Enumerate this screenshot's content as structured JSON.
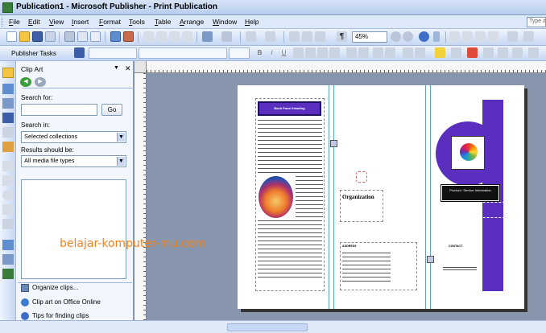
{
  "window": {
    "title": "Publication1 - Microsoft Publisher - Print Publication"
  },
  "menu": [
    "File",
    "Edit",
    "View",
    "Insert",
    "Format",
    "Tools",
    "Table",
    "Arrange",
    "Window",
    "Help"
  ],
  "help_box": {
    "placeholder": "Type a"
  },
  "toolbar": {
    "zoom": "45%",
    "publisher_tasks": "Publisher Tasks"
  },
  "taskpane": {
    "title": "Clip Art",
    "search_for_label": "Search for:",
    "search_value": "",
    "go_label": "Go",
    "search_in_label": "Search in:",
    "search_in_value": "Selected collections",
    "results_label": "Results should be:",
    "results_value": "All media file types",
    "links": [
      "Organize clips...",
      "Clip art on Office Online",
      "Tips for finding clips"
    ]
  },
  "page": {
    "heading": "Back Panel Heading",
    "organization": "Organization",
    "product": "Product / Service Information",
    "contact_label": "CONTACT",
    "address_label": "ADDRESS"
  },
  "watermark": "belajar-komputer-mu.com",
  "colors": {
    "accent": "#5a2fc0",
    "watermark": "#f2841e",
    "chrome": "#c6d8f3"
  }
}
